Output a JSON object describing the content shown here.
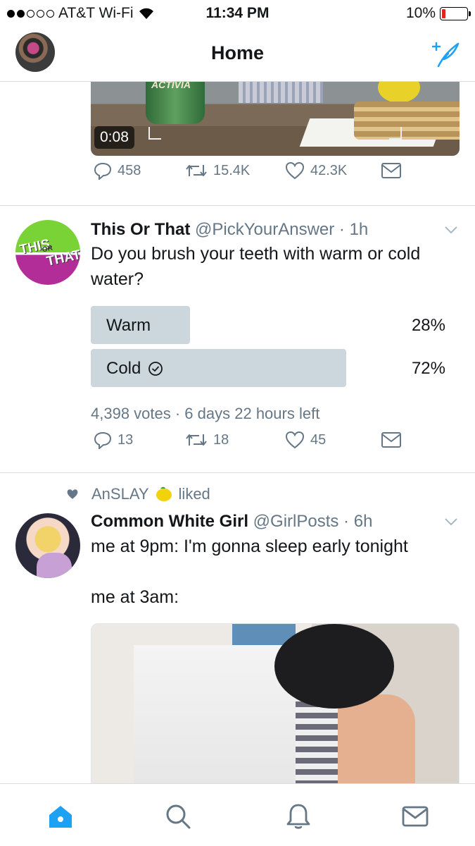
{
  "status_bar": {
    "carrier": "AT&T Wi-Fi",
    "time": "11:34 PM",
    "battery": "10%",
    "battery_level": 0.1
  },
  "header": {
    "title": "Home"
  },
  "top_tweet": {
    "video_timer": "0:08",
    "video_brand_text": "ACTIVIA",
    "replies": "458",
    "retweets": "15.4K",
    "likes": "42.3K"
  },
  "poll_tweet": {
    "name": "This Or That",
    "handle": "@PickYourAnswer",
    "time": "1h",
    "avatar_text": [
      "THIS",
      "OR",
      "THAT"
    ],
    "text": "Do you brush your teeth with warm or cold water?",
    "options": [
      {
        "label": "Warm",
        "percent": "28%",
        "share": 0.28,
        "selected": false
      },
      {
        "label": "Cold",
        "percent": "72%",
        "share": 0.72,
        "selected": true
      }
    ],
    "meta": "4,398 votes · 6 days 22 hours left",
    "replies": "13",
    "retweets": "18",
    "likes": "45"
  },
  "liked_tweet": {
    "social_user": "AnSLAY",
    "social_action": "liked",
    "name": "Common White Girl",
    "handle": "@GirlPosts",
    "time": "6h",
    "text_line1": "me at 9pm: I'm gonna sleep early tonight",
    "text_line2": "me at 3am:"
  },
  "colors": {
    "accent": "#1da1f2",
    "muted": "#657786",
    "poll_bar": "#ccd6dd",
    "divider": "#d8dde2"
  },
  "icons": {
    "tabs": [
      "home-icon",
      "search-icon",
      "notifications-icon",
      "messages-icon"
    ],
    "actions": [
      "reply-icon",
      "retweet-icon",
      "like-icon",
      "direct-message-icon"
    ]
  }
}
